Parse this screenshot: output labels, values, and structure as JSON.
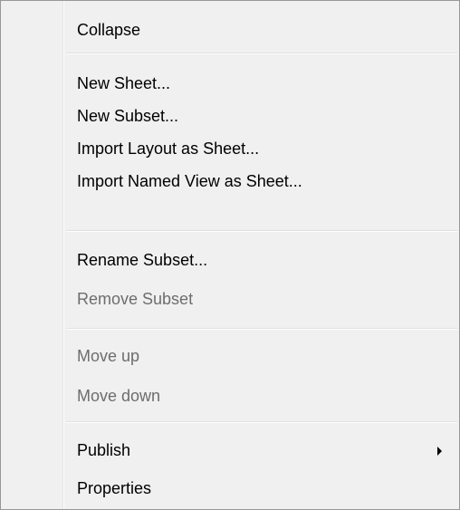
{
  "menu": {
    "items": [
      {
        "label": "Collapse",
        "enabled": true
      },
      {
        "label": "New Sheet...",
        "enabled": true
      },
      {
        "label": "New Subset...",
        "enabled": true
      },
      {
        "label": "Import Layout as Sheet...",
        "enabled": true
      },
      {
        "label": "Import Named View as Sheet...",
        "enabled": true
      },
      {
        "label": "Rename Subset...",
        "enabled": true
      },
      {
        "label": "Remove Subset",
        "enabled": false
      },
      {
        "label": "Move up",
        "enabled": false
      },
      {
        "label": "Move down",
        "enabled": false
      },
      {
        "label": "Publish",
        "enabled": true,
        "submenu_icon": "chevron-right-icon"
      },
      {
        "label": "Properties",
        "enabled": true
      }
    ]
  },
  "colors": {
    "background": "#f0f0f0",
    "border": "#979797",
    "disabled_text": "#6d6d6d",
    "separator": "#e0e0e0"
  }
}
